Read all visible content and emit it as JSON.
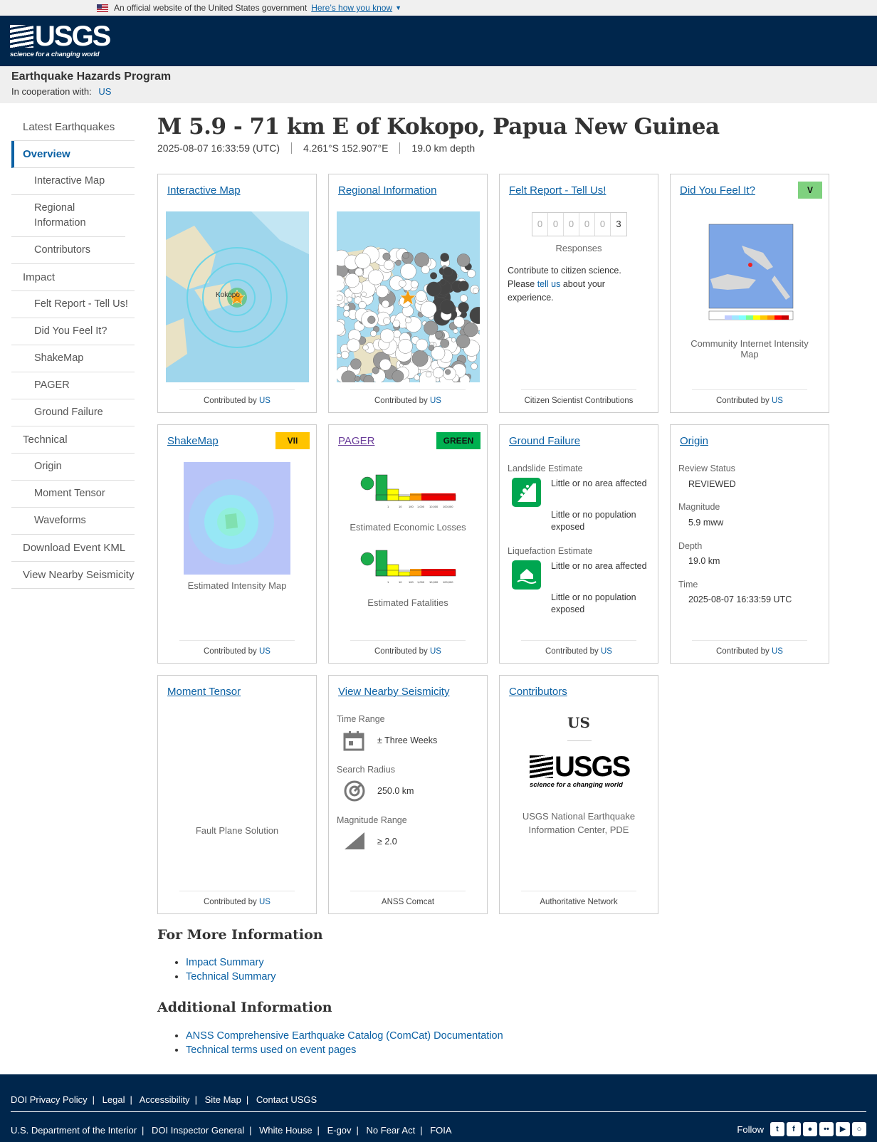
{
  "gov_banner": {
    "text": "An official website of the United States government",
    "link": "Here’s how you know"
  },
  "header": {
    "logo": "USGS",
    "tagline": "science for a changing world"
  },
  "program": {
    "title": "Earthquake Hazards Program",
    "coop_label": "In cooperation with:",
    "coop_link": "US"
  },
  "sidebar": {
    "items": [
      {
        "label": "Latest Earthquakes"
      },
      {
        "label": "Overview"
      },
      {
        "label": "Interactive Map"
      },
      {
        "label": "Regional Information"
      },
      {
        "label": "Contributors"
      },
      {
        "label": "Impact"
      },
      {
        "label": "Felt Report - Tell Us!"
      },
      {
        "label": "Did You Feel It?"
      },
      {
        "label": "ShakeMap"
      },
      {
        "label": "PAGER"
      },
      {
        "label": "Ground Failure"
      },
      {
        "label": "Technical"
      },
      {
        "label": "Origin"
      },
      {
        "label": "Moment Tensor"
      },
      {
        "label": "Waveforms"
      },
      {
        "label": "Download Event KML"
      },
      {
        "label": "View Nearby Seismicity"
      }
    ]
  },
  "event": {
    "title": "M 5.9 - 71 km E of Kokopo, Papua New Guinea",
    "time": "2025-08-07 16:33:59 (UTC)",
    "location": "4.261°S 152.907°E",
    "depth": "19.0 km depth"
  },
  "cards": {
    "interactive_map": {
      "title": "Interactive Map",
      "footer_prefix": "Contributed by",
      "footer_link": "US",
      "map_label": "Kokopo"
    },
    "regional": {
      "title": "Regional Information",
      "footer_prefix": "Contributed by",
      "footer_link": "US"
    },
    "felt": {
      "title": "Felt Report - Tell Us!",
      "digits": [
        "0",
        "0",
        "0",
        "0",
        "0",
        "3"
      ],
      "responses_label": "Responses",
      "text1": "Contribute to citizen science. Please ",
      "link": "tell us",
      "text2": " about your experience.",
      "footer": "Citizen Scientist Contributions"
    },
    "dyfi": {
      "title": "Did You Feel It?",
      "badge": "V",
      "badge_color": "#7fd17f",
      "caption": "Community Internet Intensity Map",
      "footer_prefix": "Contributed by",
      "footer_link": "US"
    },
    "shakemap": {
      "title": "ShakeMap",
      "badge": "VII",
      "badge_color": "#ffc400",
      "caption": "Estimated Intensity Map",
      "footer_prefix": "Contributed by",
      "footer_link": "US"
    },
    "pager": {
      "title": "PAGER",
      "badge": "GREEN",
      "badge_color": "#00b050",
      "caption1": "Estimated Economic Losses",
      "caption2": "Estimated Fatalities",
      "footer_prefix": "Contributed by",
      "footer_link": "US",
      "bar_levels": [
        "1",
        "10",
        "100",
        "1,000",
        "10,000",
        "100,000"
      ]
    },
    "ground_failure": {
      "title": "Ground Failure",
      "landslide_label": "Landslide Estimate",
      "landslide_area": "Little or no area affected",
      "landslide_pop": "Little or no population exposed",
      "liquefaction_label": "Liquefaction Estimate",
      "liquefaction_area": "Little or no area affected",
      "liquefaction_pop": "Little or no population exposed",
      "footer_prefix": "Contributed by",
      "footer_link": "US"
    },
    "origin": {
      "title": "Origin",
      "review_label": "Review Status",
      "review_value": "REVIEWED",
      "mag_label": "Magnitude",
      "mag_value": "5.9 mww",
      "depth_label": "Depth",
      "depth_value": "19.0 km",
      "time_label": "Time",
      "time_value": "2025-08-07 16:33:59 UTC",
      "footer_prefix": "Contributed by",
      "footer_link": "US"
    },
    "moment_tensor": {
      "title": "Moment Tensor",
      "caption": "Fault Plane Solution",
      "footer_prefix": "Contributed by",
      "footer_link": "US"
    },
    "nearby": {
      "title": "View Nearby Seismicity",
      "time_label": "Time Range",
      "time_value": "± Three Weeks",
      "radius_label": "Search Radius",
      "radius_value": "250.0 km",
      "mag_label": "Magnitude Range",
      "mag_value": "≥ 2.0",
      "footer": "ANSS Comcat"
    },
    "contributors": {
      "title": "Contributors",
      "network": "US",
      "logo": "USGS",
      "logo_tag": "science for a changing world",
      "name": "USGS National Earthquake Information Center, PDE",
      "footer": "Authoritative Network"
    }
  },
  "more_info": {
    "heading": "For More Information",
    "links": [
      "Impact Summary",
      "Technical Summary"
    ]
  },
  "additional": {
    "heading": "Additional Information",
    "links": [
      "ANSS Comprehensive Earthquake Catalog (ComCat) Documentation",
      "Technical terms used on event pages"
    ]
  },
  "footer": {
    "row1": [
      "DOI Privacy Policy",
      "Legal",
      "Accessibility",
      "Site Map",
      "Contact USGS"
    ],
    "row2": [
      "U.S. Department of the Interior",
      "DOI Inspector General",
      "White House",
      "E-gov",
      "No Fear Act",
      "FOIA"
    ],
    "follow": "Follow",
    "social_icons": [
      "twitter-icon",
      "facebook-icon",
      "github-icon",
      "flickr-icon",
      "youtube-icon",
      "instagram-icon"
    ]
  }
}
